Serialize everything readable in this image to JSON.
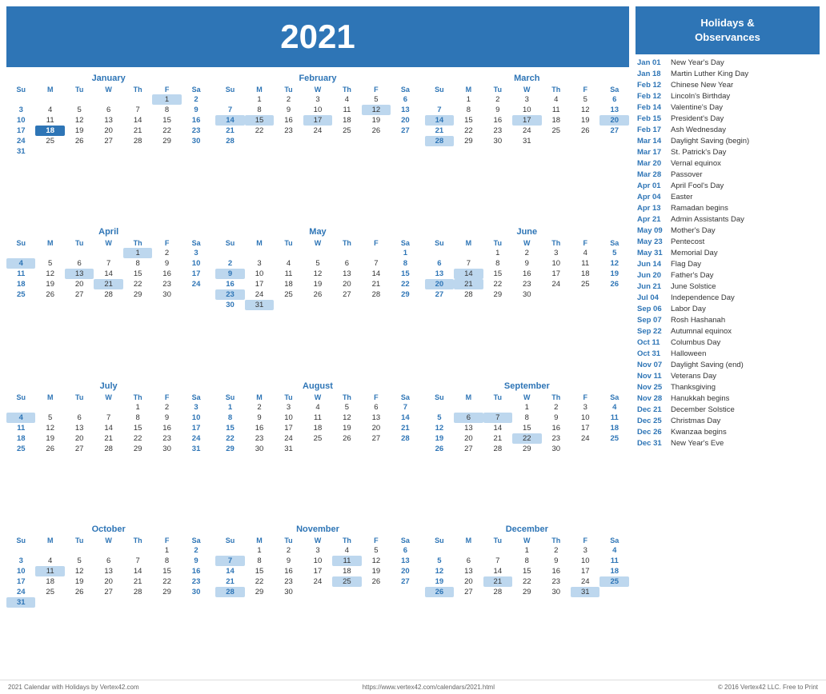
{
  "header": {
    "year": "2021"
  },
  "months": [
    {
      "name": "January",
      "days_header": [
        "Su",
        "M",
        "Tu",
        "W",
        "Th",
        "F",
        "Sa"
      ],
      "weeks": [
        [
          "",
          "",
          "",
          "",
          "",
          "1",
          "2"
        ],
        [
          "3",
          "4",
          "5",
          "6",
          "7",
          "8",
          "9"
        ],
        [
          "10",
          "11",
          "12",
          "13",
          "14",
          "15",
          "16"
        ],
        [
          "17",
          "18",
          "19",
          "20",
          "21",
          "22",
          "23"
        ],
        [
          "24",
          "25",
          "26",
          "27",
          "28",
          "29",
          "30"
        ],
        [
          "31",
          "",
          "",
          "",
          "",
          "",
          ""
        ]
      ],
      "highlights": {
        "today": [
          "18"
        ],
        "holiday": [
          "1"
        ],
        "weekend_col": [
          0,
          6
        ]
      }
    },
    {
      "name": "February",
      "days_header": [
        "Su",
        "M",
        "Tu",
        "W",
        "Th",
        "F",
        "Sa"
      ],
      "weeks": [
        [
          "",
          "1",
          "2",
          "3",
          "4",
          "5",
          "6"
        ],
        [
          "7",
          "8",
          "9",
          "10",
          "11",
          "12",
          "13"
        ],
        [
          "14",
          "15",
          "16",
          "17",
          "18",
          "19",
          "20"
        ],
        [
          "21",
          "22",
          "23",
          "24",
          "25",
          "26",
          "27"
        ],
        [
          "28",
          "",
          "",
          "",
          "",
          "",
          ""
        ]
      ],
      "highlights": {
        "today": [],
        "holiday": [
          "12",
          "14",
          "15",
          "17"
        ],
        "weekend_col": [
          0,
          6
        ]
      }
    },
    {
      "name": "March",
      "days_header": [
        "Su",
        "M",
        "Tu",
        "W",
        "Th",
        "F",
        "Sa"
      ],
      "weeks": [
        [
          "",
          "1",
          "2",
          "3",
          "4",
          "5",
          "6"
        ],
        [
          "7",
          "8",
          "9",
          "10",
          "11",
          "12",
          "13"
        ],
        [
          "14",
          "15",
          "16",
          "17",
          "18",
          "19",
          "20"
        ],
        [
          "21",
          "22",
          "23",
          "24",
          "25",
          "26",
          "27"
        ],
        [
          "28",
          "29",
          "30",
          "31",
          "",
          "",
          ""
        ]
      ],
      "highlights": {
        "today": [],
        "holiday": [
          "14",
          "17",
          "20",
          "28"
        ],
        "weekend_col": [
          0,
          6
        ]
      }
    },
    {
      "name": "April",
      "days_header": [
        "Su",
        "M",
        "Tu",
        "W",
        "Th",
        "F",
        "Sa"
      ],
      "weeks": [
        [
          "",
          "",
          "",
          "",
          "1",
          "2",
          "3"
        ],
        [
          "4",
          "5",
          "6",
          "7",
          "8",
          "9",
          "10"
        ],
        [
          "11",
          "12",
          "13",
          "14",
          "15",
          "16",
          "17"
        ],
        [
          "18",
          "19",
          "20",
          "21",
          "22",
          "23",
          "24"
        ],
        [
          "25",
          "26",
          "27",
          "28",
          "29",
          "30",
          ""
        ]
      ],
      "highlights": {
        "today": [],
        "holiday": [
          "1",
          "4",
          "13",
          "21"
        ],
        "weekend_col": [
          0,
          6
        ]
      }
    },
    {
      "name": "May",
      "days_header": [
        "Su",
        "M",
        "Tu",
        "W",
        "Th",
        "F",
        "Sa"
      ],
      "weeks": [
        [
          "",
          "",
          "",
          "",
          "",
          "",
          "1"
        ],
        [
          "2",
          "3",
          "4",
          "5",
          "6",
          "7",
          "8"
        ],
        [
          "9",
          "10",
          "11",
          "12",
          "13",
          "14",
          "15"
        ],
        [
          "16",
          "17",
          "18",
          "19",
          "20",
          "21",
          "22"
        ],
        [
          "23",
          "24",
          "25",
          "26",
          "27",
          "28",
          "29"
        ],
        [
          "30",
          "31",
          "",
          "",
          "",
          "",
          ""
        ]
      ],
      "highlights": {
        "today": [],
        "holiday": [
          "9",
          "23",
          "31"
        ],
        "weekend_col": [
          0,
          6
        ]
      }
    },
    {
      "name": "June",
      "days_header": [
        "Su",
        "M",
        "Tu",
        "W",
        "Th",
        "F",
        "Sa"
      ],
      "weeks": [
        [
          "",
          "",
          "1",
          "2",
          "3",
          "4",
          "5"
        ],
        [
          "6",
          "7",
          "8",
          "9",
          "10",
          "11",
          "12"
        ],
        [
          "13",
          "14",
          "15",
          "16",
          "17",
          "18",
          "19"
        ],
        [
          "20",
          "21",
          "22",
          "23",
          "24",
          "25",
          "26"
        ],
        [
          "27",
          "28",
          "29",
          "30",
          "",
          "",
          ""
        ]
      ],
      "highlights": {
        "today": [],
        "holiday": [
          "14",
          "20",
          "21"
        ],
        "weekend_col": [
          0,
          6
        ]
      }
    },
    {
      "name": "July",
      "days_header": [
        "Su",
        "M",
        "Tu",
        "W",
        "Th",
        "F",
        "Sa"
      ],
      "weeks": [
        [
          "",
          "",
          "",
          "",
          "1",
          "2",
          "3"
        ],
        [
          "4",
          "5",
          "6",
          "7",
          "8",
          "9",
          "10"
        ],
        [
          "11",
          "12",
          "13",
          "14",
          "15",
          "16",
          "17"
        ],
        [
          "18",
          "19",
          "20",
          "21",
          "22",
          "23",
          "24"
        ],
        [
          "25",
          "26",
          "27",
          "28",
          "29",
          "30",
          "31"
        ]
      ],
      "highlights": {
        "today": [],
        "holiday": [
          "4"
        ],
        "weekend_col": [
          0,
          6
        ]
      }
    },
    {
      "name": "August",
      "days_header": [
        "Su",
        "M",
        "Tu",
        "W",
        "Th",
        "F",
        "Sa"
      ],
      "weeks": [
        [
          "1",
          "2",
          "3",
          "4",
          "5",
          "6",
          "7"
        ],
        [
          "8",
          "9",
          "10",
          "11",
          "12",
          "13",
          "14"
        ],
        [
          "15",
          "16",
          "17",
          "18",
          "19",
          "20",
          "21"
        ],
        [
          "22",
          "23",
          "24",
          "25",
          "26",
          "27",
          "28"
        ],
        [
          "29",
          "30",
          "31",
          "",
          "",
          "",
          ""
        ]
      ],
      "highlights": {
        "today": [],
        "holiday": [],
        "weekend_col": [
          0,
          6
        ]
      }
    },
    {
      "name": "September",
      "days_header": [
        "Su",
        "M",
        "Tu",
        "W",
        "Th",
        "F",
        "Sa"
      ],
      "weeks": [
        [
          "",
          "",
          "",
          "1",
          "2",
          "3",
          "4"
        ],
        [
          "5",
          "6",
          "7",
          "8",
          "9",
          "10",
          "11"
        ],
        [
          "12",
          "13",
          "14",
          "15",
          "16",
          "17",
          "18"
        ],
        [
          "19",
          "20",
          "21",
          "22",
          "23",
          "24",
          "25"
        ],
        [
          "26",
          "27",
          "28",
          "29",
          "30",
          "",
          ""
        ]
      ],
      "highlights": {
        "today": [],
        "holiday": [
          "6",
          "7",
          "22"
        ],
        "weekend_col": [
          0,
          6
        ]
      }
    },
    {
      "name": "October",
      "days_header": [
        "Su",
        "M",
        "Tu",
        "W",
        "Th",
        "F",
        "Sa"
      ],
      "weeks": [
        [
          "",
          "",
          "",
          "",
          "",
          "1",
          "2"
        ],
        [
          "3",
          "4",
          "5",
          "6",
          "7",
          "8",
          "9"
        ],
        [
          "10",
          "11",
          "12",
          "13",
          "14",
          "15",
          "16"
        ],
        [
          "17",
          "18",
          "19",
          "20",
          "21",
          "22",
          "23"
        ],
        [
          "24",
          "25",
          "26",
          "27",
          "28",
          "29",
          "30"
        ],
        [
          "31",
          "",
          "",
          "",
          "",
          "",
          ""
        ]
      ],
      "highlights": {
        "today": [],
        "holiday": [
          "11",
          "31"
        ],
        "weekend_col": [
          0,
          6
        ]
      }
    },
    {
      "name": "November",
      "days_header": [
        "Su",
        "M",
        "Tu",
        "W",
        "Th",
        "F",
        "Sa"
      ],
      "weeks": [
        [
          "",
          "1",
          "2",
          "3",
          "4",
          "5",
          "6"
        ],
        [
          "7",
          "8",
          "9",
          "10",
          "11",
          "12",
          "13"
        ],
        [
          "14",
          "15",
          "16",
          "17",
          "18",
          "19",
          "20"
        ],
        [
          "21",
          "22",
          "23",
          "24",
          "25",
          "26",
          "27"
        ],
        [
          "28",
          "29",
          "30",
          "",
          "",
          "",
          ""
        ]
      ],
      "highlights": {
        "today": [],
        "holiday": [
          "7",
          "11",
          "25",
          "28"
        ],
        "weekend_col": [
          0,
          6
        ]
      }
    },
    {
      "name": "December",
      "days_header": [
        "Su",
        "M",
        "Tu",
        "W",
        "Th",
        "F",
        "Sa"
      ],
      "weeks": [
        [
          "",
          "",
          "",
          "1",
          "2",
          "3",
          "4"
        ],
        [
          "5",
          "6",
          "7",
          "8",
          "9",
          "10",
          "11"
        ],
        [
          "12",
          "13",
          "14",
          "15",
          "16",
          "17",
          "18"
        ],
        [
          "19",
          "20",
          "21",
          "22",
          "23",
          "24",
          "25"
        ],
        [
          "26",
          "27",
          "28",
          "29",
          "30",
          "31",
          ""
        ]
      ],
      "highlights": {
        "today": [],
        "holiday": [
          "21",
          "25",
          "26",
          "31"
        ],
        "weekend_col": [
          0,
          6
        ]
      }
    }
  ],
  "holidays_panel": {
    "title": "Holidays &\nObservances",
    "items": [
      {
        "date": "Jan 01",
        "name": "New Year's Day"
      },
      {
        "date": "Jan 18",
        "name": "Martin Luther King Day"
      },
      {
        "date": "Feb 12",
        "name": "Chinese New Year"
      },
      {
        "date": "Feb 12",
        "name": "Lincoln's Birthday"
      },
      {
        "date": "Feb 14",
        "name": "Valentine's Day"
      },
      {
        "date": "Feb 15",
        "name": "President's Day"
      },
      {
        "date": "Feb 17",
        "name": "Ash Wednesday"
      },
      {
        "date": "Mar 14",
        "name": "Daylight Saving (begin)"
      },
      {
        "date": "Mar 17",
        "name": "St. Patrick's Day"
      },
      {
        "date": "Mar 20",
        "name": "Vernal equinox"
      },
      {
        "date": "Mar 28",
        "name": "Passover"
      },
      {
        "date": "Apr 01",
        "name": "April Fool's Day"
      },
      {
        "date": "Apr 04",
        "name": "Easter"
      },
      {
        "date": "Apr 13",
        "name": "Ramadan begins"
      },
      {
        "date": "Apr 21",
        "name": "Admin Assistants Day"
      },
      {
        "date": "May 09",
        "name": "Mother's Day"
      },
      {
        "date": "May 23",
        "name": "Pentecost"
      },
      {
        "date": "May 31",
        "name": "Memorial Day"
      },
      {
        "date": "Jun 14",
        "name": "Flag Day"
      },
      {
        "date": "Jun 20",
        "name": "Father's Day"
      },
      {
        "date": "Jun 21",
        "name": "June Solstice"
      },
      {
        "date": "Jul 04",
        "name": "Independence Day"
      },
      {
        "date": "Sep 06",
        "name": "Labor Day"
      },
      {
        "date": "Sep 07",
        "name": "Rosh Hashanah"
      },
      {
        "date": "Sep 22",
        "name": "Autumnal equinox"
      },
      {
        "date": "Oct 11",
        "name": "Columbus Day"
      },
      {
        "date": "Oct 31",
        "name": "Halloween"
      },
      {
        "date": "Nov 07",
        "name": "Daylight Saving (end)"
      },
      {
        "date": "Nov 11",
        "name": "Veterans Day"
      },
      {
        "date": "Nov 25",
        "name": "Thanksgiving"
      },
      {
        "date": "Nov 28",
        "name": "Hanukkah begins"
      },
      {
        "date": "Dec 21",
        "name": "December Solstice"
      },
      {
        "date": "Dec 25",
        "name": "Christmas Day"
      },
      {
        "date": "Dec 26",
        "name": "Kwanzaa begins"
      },
      {
        "date": "Dec 31",
        "name": "New Year's Eve"
      }
    ]
  },
  "footer": {
    "left": "2021 Calendar with Holidays by Vertex42.com",
    "center": "https://www.vertex42.com/calendars/2021.html",
    "right": "© 2016 Vertex42 LLC. Free to Print"
  }
}
